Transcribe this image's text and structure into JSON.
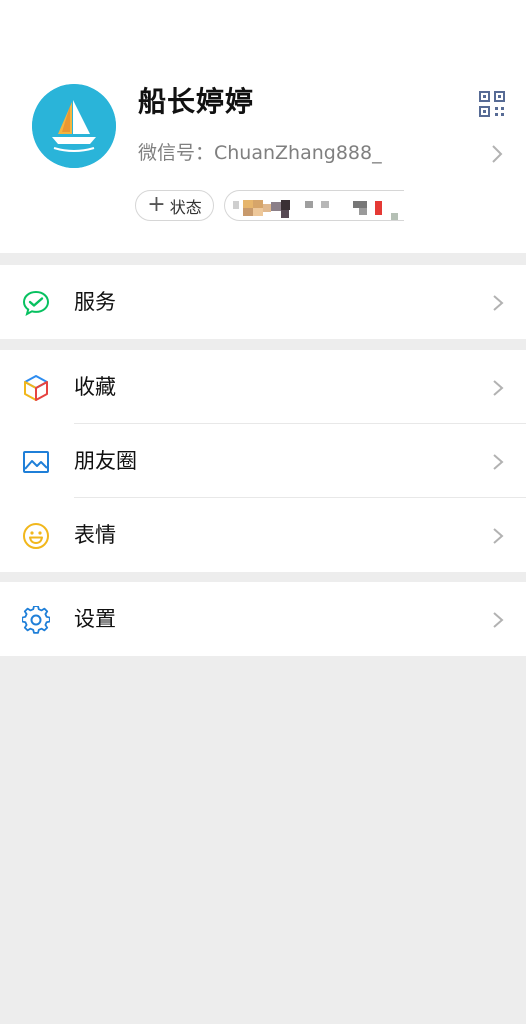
{
  "profile": {
    "nickname": "船长婷婷",
    "wechat_id_label": "微信号：ChuanZhang888_",
    "status_button_label": "状态",
    "friend_status_text": ""
  },
  "menu": {
    "services": {
      "label": "服务",
      "icon": "wechat-pay-icon"
    },
    "favorites": {
      "label": "收藏",
      "icon": "cube-icon"
    },
    "moments": {
      "label": "朋友圈",
      "icon": "image-icon"
    },
    "stickers": {
      "label": "表情",
      "icon": "smiley-icon"
    },
    "settings": {
      "label": "设置",
      "icon": "gear-icon"
    }
  },
  "colors": {
    "accent_green": "#07c160",
    "avatar_bg": "#2ab4d9",
    "moments_blue": "#1f7fd8",
    "sticker_yellow": "#f1b71c"
  }
}
